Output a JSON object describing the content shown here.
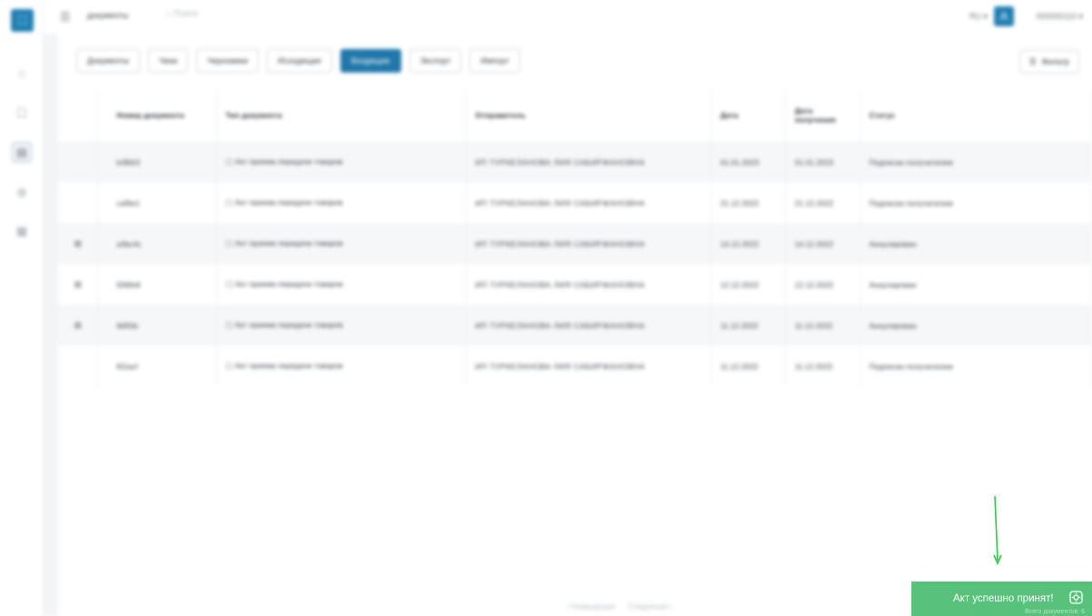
{
  "header": {
    "breadcrumb": "документы",
    "search_placeholder": "Поиск",
    "lang": "RU ▾",
    "avatar": "A",
    "user_id": "000000110 ▾"
  },
  "tabs": [
    "Документы",
    "Чеки",
    "Черновики",
    "Исходящие",
    "Входящие",
    "Экспорт",
    "Импорт"
  ],
  "active_tab": "Входящие",
  "filter_label": "Фильтр",
  "table": {
    "columns": [
      "",
      "Номер документа",
      "Тип документа",
      "Отправитель",
      "Дата",
      "Дата получения",
      "Статус"
    ],
    "rows": [
      {
        "icon": "",
        "number": "b3fb02",
        "type": "Акт приема передачи товаров",
        "sender": "ИП ТУРКЕЛАНОВА ЛИЯ САБИРЖАНОВНА",
        "date": "01.01.2023",
        "received": "01.01.2023",
        "status": "Подписан получателем"
      },
      {
        "icon": "",
        "number": "caf9e1",
        "type": "Акт приема передачи товаров",
        "sender": "ИП ТУРКЕЛАНОВА ЛИЯ САБИРЖАНОВНА",
        "date": "21.12.2022",
        "received": "21.12.2022",
        "status": "Подписан получателем"
      },
      {
        "icon": "▤",
        "number": "a3bc4c",
        "type": "Акт приема передачи товаров",
        "sender": "ИП ТУРКЕЛАНОВА ЛИЯ САБИРЖАНОВНА",
        "date": "14.12.2022",
        "received": "14.12.2022",
        "status": "Аннулирован"
      },
      {
        "icon": "▤",
        "number": "936fe8",
        "type": "Акт приема передачи товаров",
        "sender": "ИП ТУРКЕЛАНОВА ЛИЯ САБИРЖАНОВНА",
        "date": "12.12.2022",
        "received": "12.12.2022",
        "status": "Аннулирован"
      },
      {
        "icon": "▤",
        "number": "8d55b",
        "type": "Акт приема передачи товаров",
        "sender": "ИП ТУРКЕЛАНОВА ЛИЯ САБИРЖАНОВНА",
        "date": "11.12.2022",
        "received": "11.12.2022",
        "status": "Аннулирован"
      },
      {
        "icon": "",
        "number": "f02acf",
        "type": "Акт приема передачи товаров",
        "sender": "ИП ТУРКЕЛАНОВА ЛИЯ САБИРЖАНОВНА",
        "date": "11.12.2022",
        "received": "11.12.2022",
        "status": "Подписан получателем"
      }
    ]
  },
  "pager": {
    "prev": "‹ Предыдущая",
    "next": "Следующая ›"
  },
  "toast": {
    "message": "Акт успешно принят!",
    "footer": "Всего документов: 6"
  },
  "colors": {
    "accent": "#1f77aa",
    "toast": "#57c27a",
    "arrow": "#2ecc40"
  }
}
